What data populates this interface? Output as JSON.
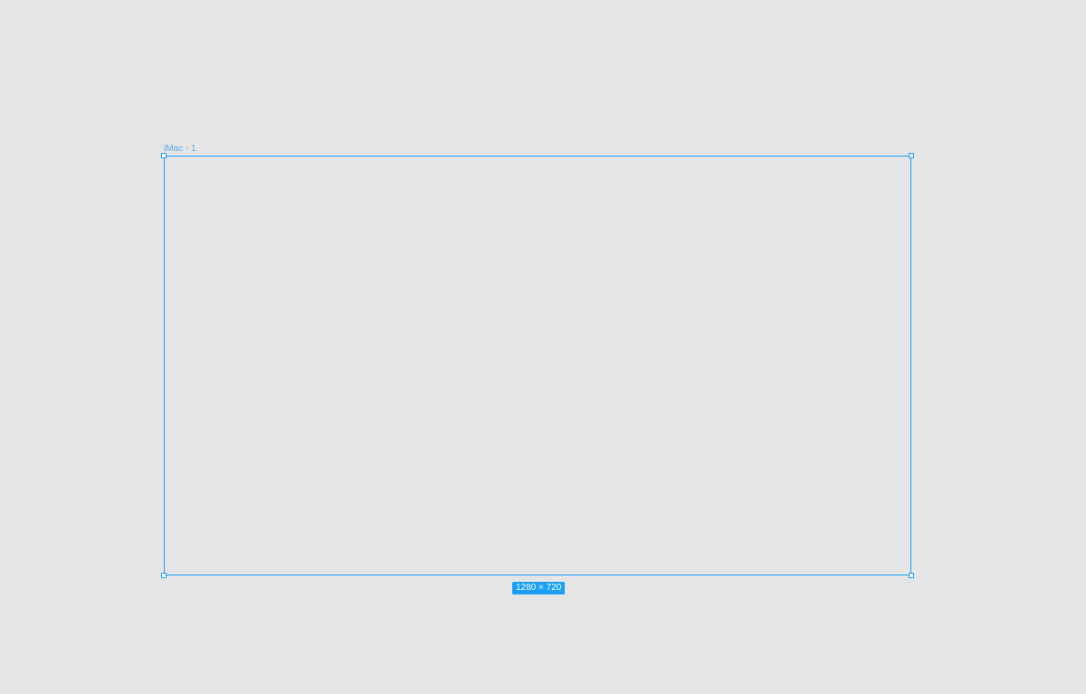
{
  "canvas": {
    "background": "#e5e5e5",
    "selection_color": "#18a0fb",
    "frame": {
      "name": "iMac - 1",
      "size_label": "1280 × 720"
    }
  }
}
